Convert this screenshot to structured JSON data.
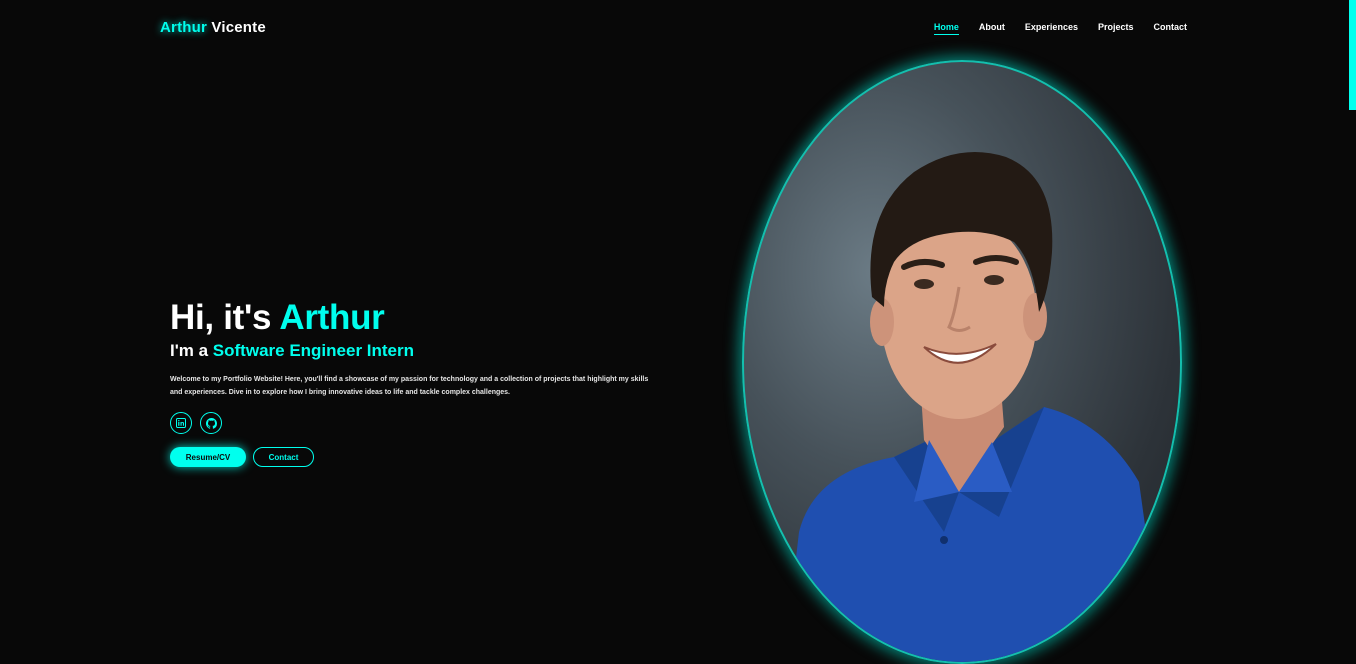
{
  "header": {
    "logo_first": "Arthur",
    "logo_last": " Vicente",
    "nav": [
      "Home",
      "About",
      "Experiences",
      "Projects",
      "Contact"
    ]
  },
  "hero": {
    "greeting": "Hi, it's ",
    "name": "Arthur",
    "role_prefix": "I'm a ",
    "role": "Software Engineer Intern",
    "description": "Welcome to my Portfolio Website! Here, you'll find a showcase of my passion for technology and a collection of projects that highlight my skills and experiences. Dive in to explore how I bring innovative ideas to life and tackle complex challenges.",
    "socials": [
      "linkedin-icon",
      "github-icon"
    ],
    "buttons": {
      "resume": "Resume/CV",
      "contact": "Contact"
    }
  },
  "colors": {
    "accent": "#00ffee",
    "background": "#080808"
  }
}
